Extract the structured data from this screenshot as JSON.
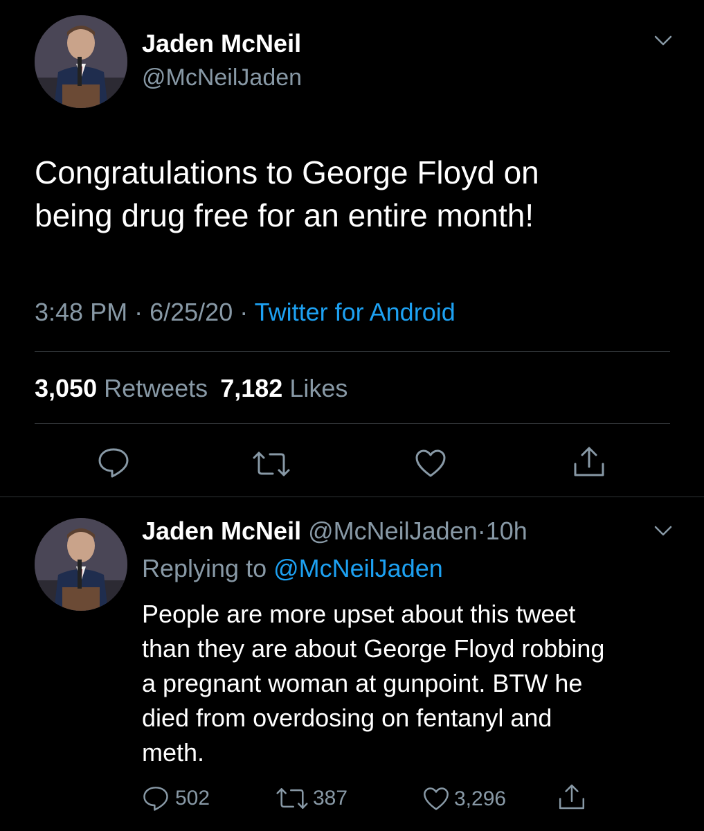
{
  "tweet": {
    "author_name": "Jaden McNeil",
    "author_handle": "@McNeilJaden",
    "text_line1": "Congratulations to George Floyd on",
    "text_line2": "being drug free for an entire month!",
    "time": "3:48 PM",
    "date": "6/25/20",
    "source": "Twitter for Android",
    "sep": "·",
    "retweets_count": "3,050",
    "retweets_label": "Retweets",
    "likes_count": "7,182",
    "likes_label": "Likes"
  },
  "reply": {
    "author_name": "Jaden McNeil",
    "author_handle": "@McNeilJaden",
    "sep": "·",
    "time_ago": "10h",
    "replying_prefix": "Replying to",
    "replying_to": "@McNeilJaden",
    "lines": [
      "People are more upset about this tweet",
      "than they are about George Floyd robbing",
      "a pregnant woman at gunpoint. BTW he",
      "died from overdosing on fentanyl and",
      "meth."
    ],
    "reply_count": "502",
    "retweet_count": "387",
    "like_count": "3,296"
  },
  "icons": [
    "chevron-down-icon",
    "reply-icon",
    "retweet-icon",
    "like-icon",
    "share-icon"
  ],
  "colors": {
    "background": "#000000",
    "secondary_text": "#8899a6",
    "link": "#1da1f2",
    "divider": "#2f3336"
  }
}
